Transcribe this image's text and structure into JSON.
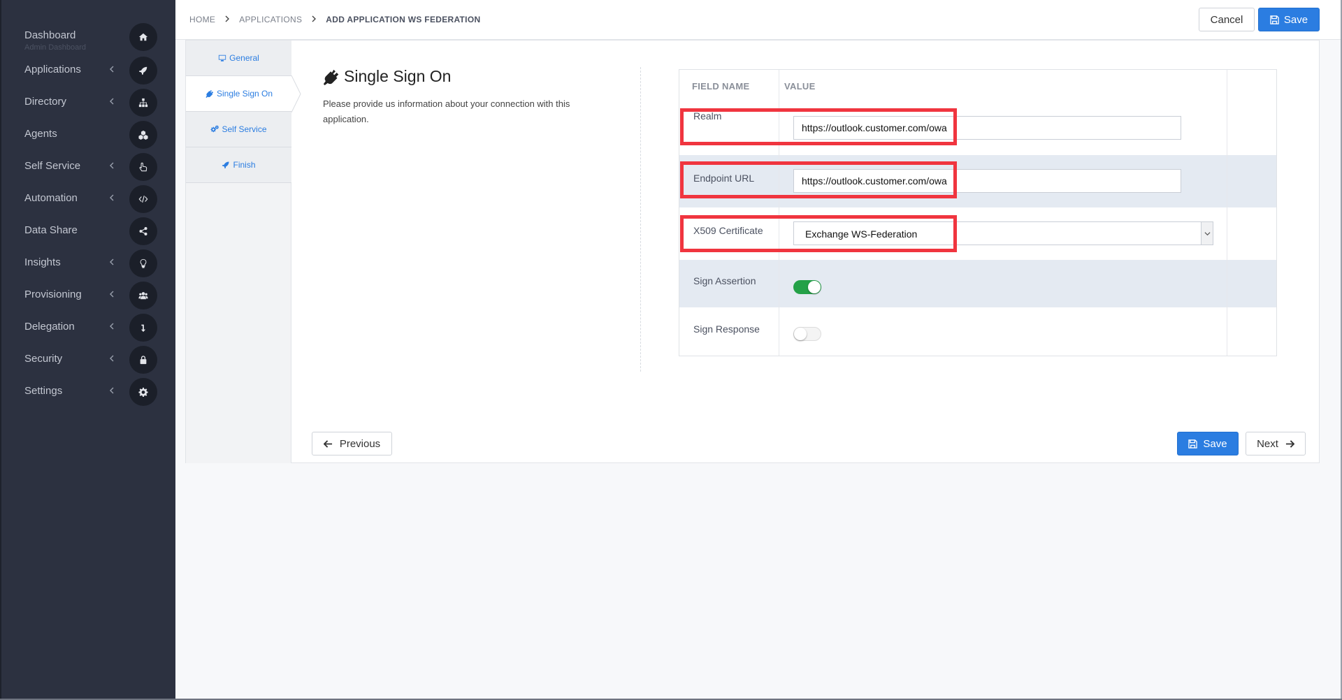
{
  "sidebar": {
    "items": [
      {
        "label": "Dashboard",
        "sub": "Admin Dashboard",
        "icon": "home-icon",
        "chevron": false
      },
      {
        "label": "Applications",
        "icon": "rocket-icon",
        "chevron": true
      },
      {
        "label": "Directory",
        "icon": "sitemap-icon",
        "chevron": true
      },
      {
        "label": "Agents",
        "icon": "cubes-icon",
        "chevron": false
      },
      {
        "label": "Self Service",
        "icon": "hand-pointer-icon",
        "chevron": true
      },
      {
        "label": "Automation",
        "icon": "code-icon",
        "chevron": true
      },
      {
        "label": "Data Share",
        "icon": "share-alt-icon",
        "chevron": false
      },
      {
        "label": "Insights",
        "icon": "lightbulb-icon",
        "chevron": true
      },
      {
        "label": "Provisioning",
        "icon": "users-icon",
        "chevron": true
      },
      {
        "label": "Delegation",
        "icon": "level-down-icon",
        "chevron": true
      },
      {
        "label": "Security",
        "icon": "lock-icon",
        "chevron": true
      },
      {
        "label": "Settings",
        "icon": "gear-icon",
        "chevron": true
      }
    ]
  },
  "breadcrumb": {
    "home": "HOME",
    "applications": "APPLICATIONS",
    "current": "ADD APPLICATION WS FEDERATION"
  },
  "header": {
    "cancel_label": "Cancel",
    "save_label": "Save"
  },
  "wizard": {
    "steps": [
      {
        "label": "General",
        "icon": "desktop-icon",
        "active": false
      },
      {
        "label": "Single Sign On",
        "icon": "plug-icon",
        "active": true
      },
      {
        "label": "Self Service",
        "icon": "cogs-icon",
        "active": false
      },
      {
        "label": "Finish",
        "icon": "rocket-icon",
        "active": false
      }
    ]
  },
  "section": {
    "title": "Single Sign On",
    "description": "Please provide us information about your connection with this application."
  },
  "table": {
    "headers": {
      "field": "FIELD NAME",
      "value": "VALUE"
    },
    "realm": {
      "label": "Realm",
      "value": "https://outlook.customer.com/owa"
    },
    "endpoint": {
      "label": "Endpoint URL",
      "value": "https://outlook.customer.com/owa"
    },
    "certificate": {
      "label": "X509 Certificate",
      "selected": "Exchange WS-Federation"
    },
    "sign_assertion": {
      "label": "Sign Assertion",
      "enabled": true
    },
    "sign_response": {
      "label": "Sign Response",
      "enabled": false
    }
  },
  "footer": {
    "previous_label": "Previous",
    "save_label": "Save",
    "next_label": "Next"
  },
  "colors": {
    "sidebar": "#2c3140",
    "primary": "#2b7de1",
    "highlight": "#f0353f",
    "toggle_on": "#24a148",
    "row_shade": "#e4eaf2"
  }
}
